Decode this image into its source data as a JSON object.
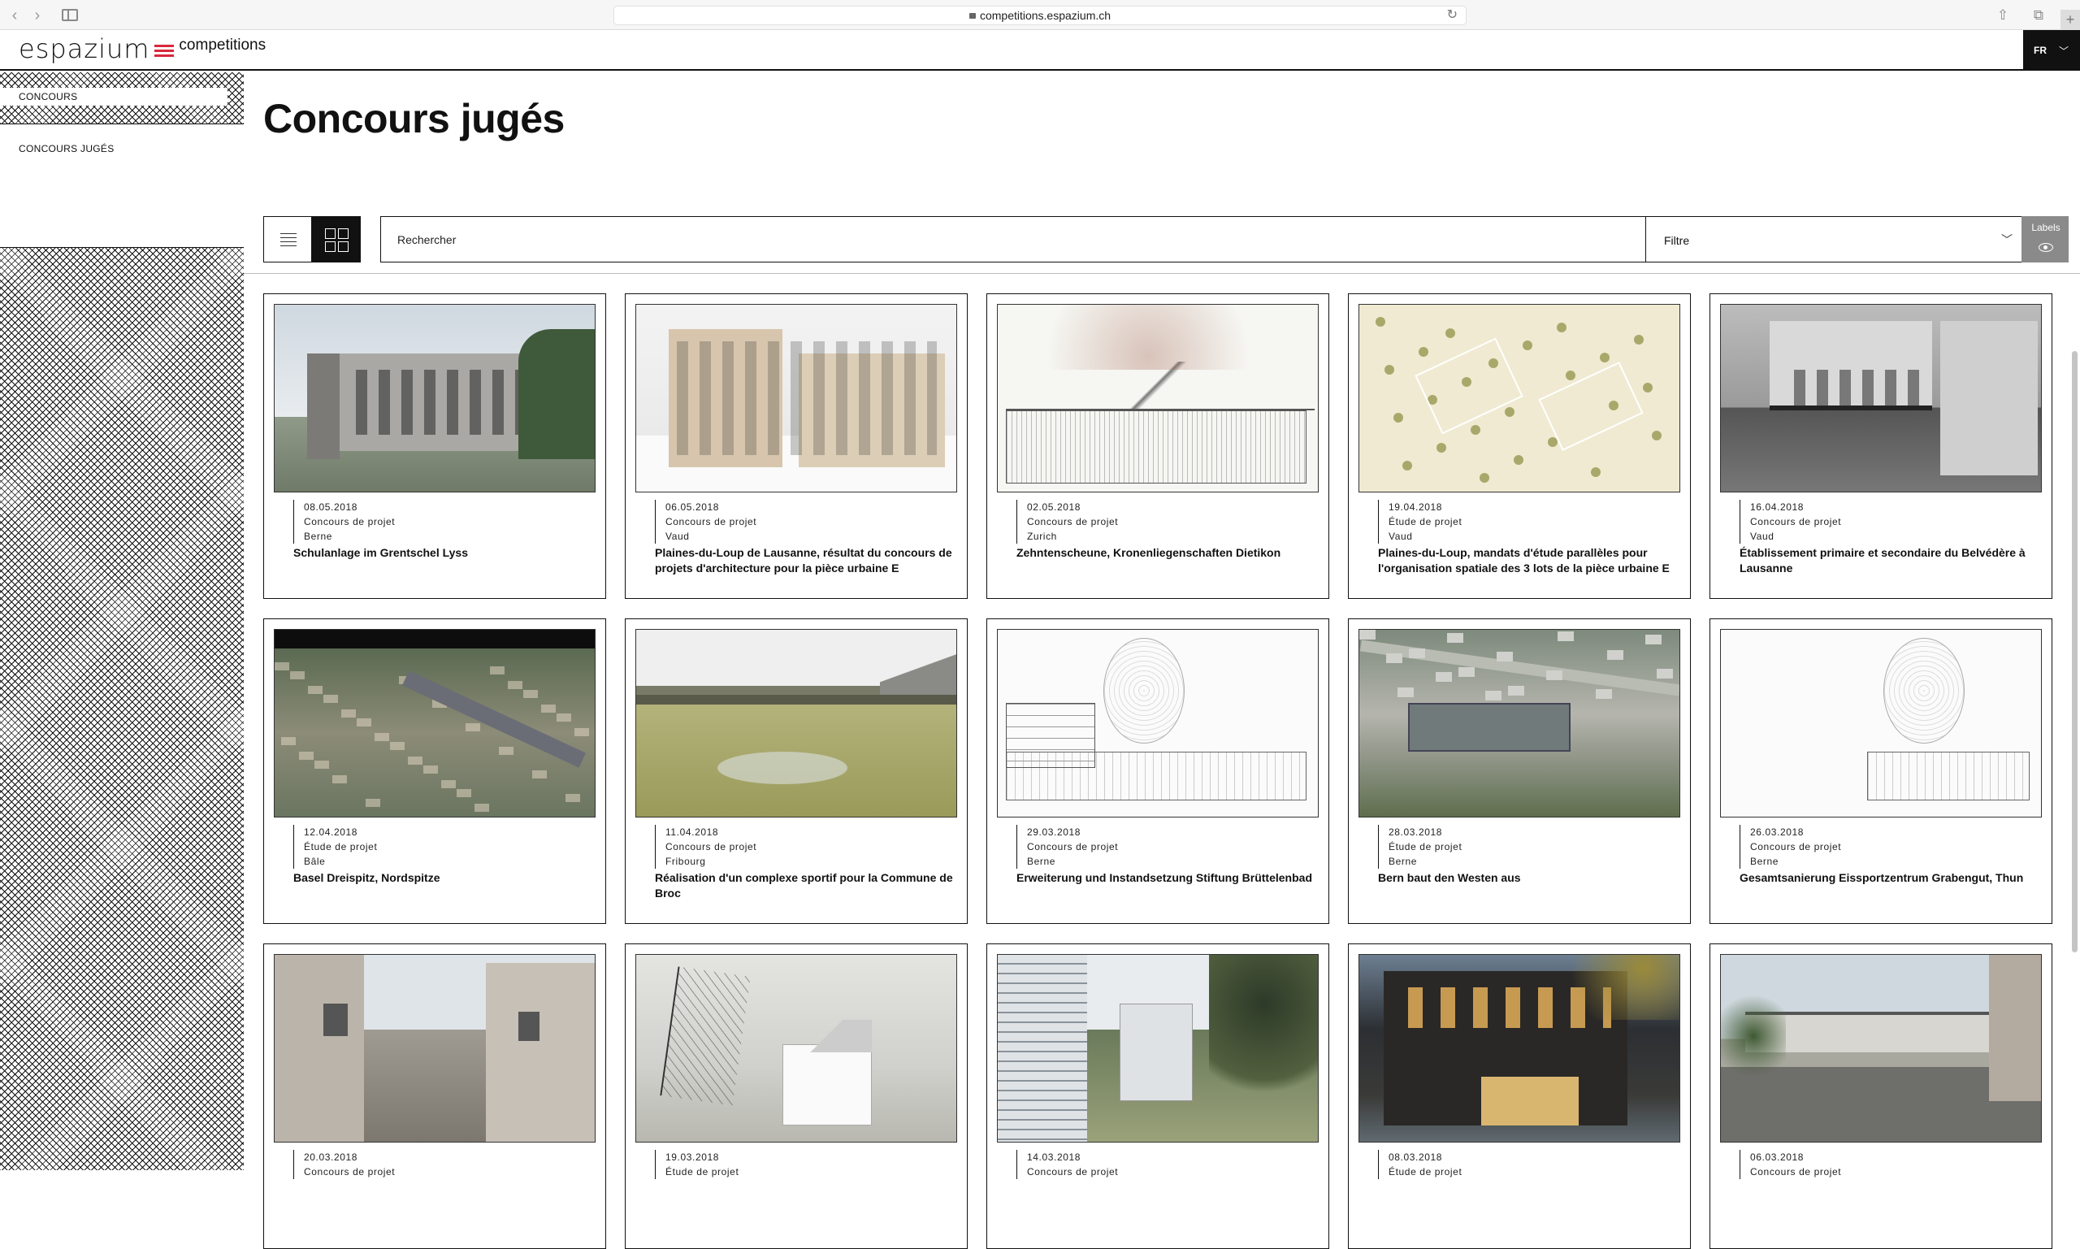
{
  "browser": {
    "url": "competitions.espazium.ch"
  },
  "header": {
    "logo_word": "espazium",
    "logo_sub": "competitions",
    "lang_code": "FR"
  },
  "sidebar": {
    "items": [
      {
        "label": "CONCOURS",
        "active": true
      },
      {
        "label": "CONCOURS JUGÉS",
        "active": false
      }
    ]
  },
  "main": {
    "title": "Concours jugés",
    "search_placeholder": "Rechercher",
    "filter_label": "Filtre",
    "labels_toggle": "Labels"
  },
  "cards": [
    {
      "date": "08.05.2018",
      "type": "Concours de projet",
      "region": "Berne",
      "title": "Schulanlage im Grentschel Lyss",
      "thumb": "t-sky-day"
    },
    {
      "date": "06.05.2018",
      "type": "Concours de projet",
      "region": "Vaud",
      "title": "Plaines-du-Loup de Lausanne, résultat du concours de projets d'architecture pour la pièce urbaine E",
      "thumb": "t-snow"
    },
    {
      "date": "02.05.2018",
      "type": "Concours de projet",
      "region": "Zurich",
      "title": "Zehntenscheune, Kronenliegenschaften Dietikon",
      "thumb": "t-sketch"
    },
    {
      "date": "19.04.2018",
      "type": "Étude de projet",
      "region": "Vaud",
      "title": "Plaines-du-Loup, mandats d'étude parallèles pour l'organisation spatiale des 3 lots de la pièce urbaine E",
      "thumb": "t-plan"
    },
    {
      "date": "16.04.2018",
      "type": "Concours de projet",
      "region": "Vaud",
      "title": "Établissement primaire et secondaire du Belvédère à Lausanne",
      "thumb": "t-bw"
    },
    {
      "date": "12.04.2018",
      "type": "Étude de projet",
      "region": "Bâle",
      "title": "Basel Dreispitz, Nordspitze",
      "thumb": "t-model"
    },
    {
      "date": "11.04.2018",
      "type": "Concours de projet",
      "region": "Fribourg",
      "title": "Réalisation d'un complexe sportif pour la Commune de Broc",
      "thumb": "t-field"
    },
    {
      "date": "29.03.2018",
      "type": "Concours de projet",
      "region": "Berne",
      "title": "Erweiterung und Instandsetzung Stiftung Brüttelenbad",
      "thumb": "t-lineart"
    },
    {
      "date": "28.03.2018",
      "type": "Étude de projet",
      "region": "Berne",
      "title": "Bern baut den Westen aus",
      "thumb": "t-aerial"
    },
    {
      "date": "26.03.2018",
      "type": "Concours de projet",
      "region": "Berne",
      "title": "Gesamtsanierung Eissportzentrum Grabengut, Thun",
      "thumb": "t-lineart"
    },
    {
      "date": "20.03.2018",
      "type": "Concours de projet",
      "region": "",
      "title": "",
      "thumb": "t-street"
    },
    {
      "date": "19.03.2018",
      "type": "Étude de projet",
      "region": "",
      "title": "",
      "thumb": "t-wood"
    },
    {
      "date": "14.03.2018",
      "type": "Concours de projet",
      "region": "",
      "title": "",
      "thumb": "t-trees"
    },
    {
      "date": "08.03.2018",
      "type": "Étude de projet",
      "region": "",
      "title": "",
      "thumb": "t-dark"
    },
    {
      "date": "06.03.2018",
      "type": "Concours de projet",
      "region": "",
      "title": "",
      "thumb": "t-park"
    }
  ]
}
